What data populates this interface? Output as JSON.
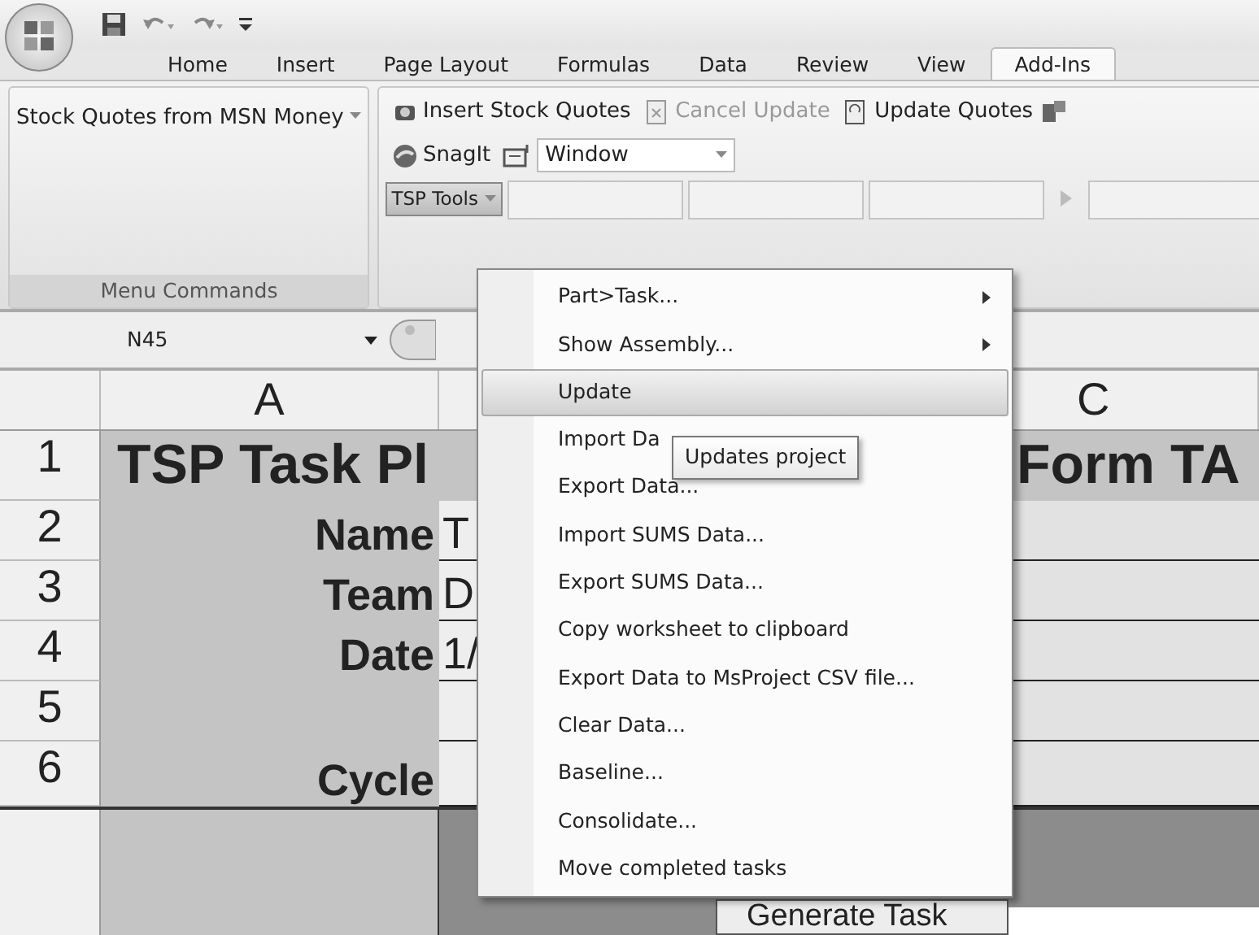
{
  "tabs": [
    {
      "label": "Home",
      "selected": false
    },
    {
      "label": "Insert",
      "selected": false
    },
    {
      "label": "Page Layout",
      "selected": false
    },
    {
      "label": "Formulas",
      "selected": false
    },
    {
      "label": "Data",
      "selected": false
    },
    {
      "label": "Review",
      "selected": false
    },
    {
      "label": "View",
      "selected": false
    },
    {
      "label": "Add-Ins",
      "selected": true
    }
  ],
  "ribbon": {
    "menu_commands": {
      "button": "Stock Quotes from MSN Money",
      "label": "Menu Commands"
    },
    "toolbar": {
      "row_1": [
        {
          "label": "Insert Stock Quotes",
          "disabled": false
        },
        {
          "label": "Cancel Update",
          "disabled": true
        },
        {
          "label": "Update Quotes",
          "disabled": false
        }
      ],
      "snagit": "SnagIt",
      "window_combo": "Window",
      "tsp_tools": {
        "label": "TSP Tools",
        "pressed": true
      }
    }
  },
  "name_box": "N45",
  "columns": [
    "A",
    "C"
  ],
  "rows": [
    {
      "number": "1",
      "a": "TSP Task Pl",
      "b": "",
      "c": "Form TA"
    },
    {
      "number": "2",
      "a": "Name",
      "b": "T",
      "c": ""
    },
    {
      "number": "3",
      "a": "Team",
      "b": "D",
      "c": ""
    },
    {
      "number": "4",
      "a": "Date",
      "b": "1/",
      "c": ""
    },
    {
      "number": "5",
      "a": "",
      "b": "",
      "c": ""
    },
    {
      "number": "6",
      "a": "Cycle",
      "b": "",
      "c": ""
    }
  ],
  "sheet_button": "Generate Task",
  "menu": [
    {
      "label": "Part>Task...",
      "submenu": true,
      "selected": false
    },
    {
      "label": "Show Assembly...",
      "submenu": true,
      "selected": false
    },
    {
      "label": "Update",
      "submenu": false,
      "selected": true
    },
    {
      "label": "Import Da",
      "submenu": false,
      "selected": false
    },
    {
      "label": "Export Data...",
      "submenu": false,
      "selected": false
    },
    {
      "label": "Import SUMS Data...",
      "submenu": false,
      "selected": false
    },
    {
      "label": "Export SUMS Data...",
      "submenu": false,
      "selected": false
    },
    {
      "label": "Copy worksheet to clipboard",
      "submenu": false,
      "selected": false
    },
    {
      "label": "Export Data to MsProject CSV file...",
      "submenu": false,
      "selected": false
    },
    {
      "label": "Clear Data...",
      "submenu": false,
      "selected": false
    },
    {
      "label": "Baseline...",
      "submenu": false,
      "selected": false
    },
    {
      "label": "Consolidate...",
      "submenu": false,
      "selected": false
    },
    {
      "label": "Move completed tasks",
      "submenu": false,
      "selected": false
    }
  ],
  "tooltip": "Updates project"
}
